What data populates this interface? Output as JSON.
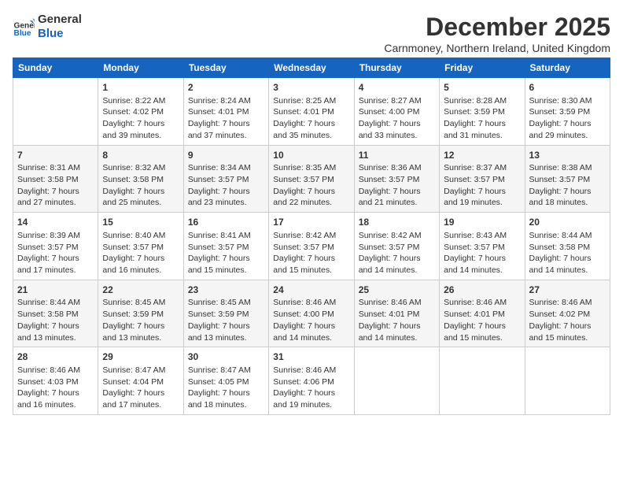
{
  "header": {
    "logo_line1": "General",
    "logo_line2": "Blue",
    "month": "December 2025",
    "location": "Carnmoney, Northern Ireland, United Kingdom"
  },
  "weekdays": [
    "Sunday",
    "Monday",
    "Tuesday",
    "Wednesday",
    "Thursday",
    "Friday",
    "Saturday"
  ],
  "weeks": [
    [
      {
        "day": "",
        "sunrise": "",
        "sunset": "",
        "daylight": ""
      },
      {
        "day": "1",
        "sunrise": "Sunrise: 8:22 AM",
        "sunset": "Sunset: 4:02 PM",
        "daylight": "Daylight: 7 hours and 39 minutes."
      },
      {
        "day": "2",
        "sunrise": "Sunrise: 8:24 AM",
        "sunset": "Sunset: 4:01 PM",
        "daylight": "Daylight: 7 hours and 37 minutes."
      },
      {
        "day": "3",
        "sunrise": "Sunrise: 8:25 AM",
        "sunset": "Sunset: 4:01 PM",
        "daylight": "Daylight: 7 hours and 35 minutes."
      },
      {
        "day": "4",
        "sunrise": "Sunrise: 8:27 AM",
        "sunset": "Sunset: 4:00 PM",
        "daylight": "Daylight: 7 hours and 33 minutes."
      },
      {
        "day": "5",
        "sunrise": "Sunrise: 8:28 AM",
        "sunset": "Sunset: 3:59 PM",
        "daylight": "Daylight: 7 hours and 31 minutes."
      },
      {
        "day": "6",
        "sunrise": "Sunrise: 8:30 AM",
        "sunset": "Sunset: 3:59 PM",
        "daylight": "Daylight: 7 hours and 29 minutes."
      }
    ],
    [
      {
        "day": "7",
        "sunrise": "Sunrise: 8:31 AM",
        "sunset": "Sunset: 3:58 PM",
        "daylight": "Daylight: 7 hours and 27 minutes."
      },
      {
        "day": "8",
        "sunrise": "Sunrise: 8:32 AM",
        "sunset": "Sunset: 3:58 PM",
        "daylight": "Daylight: 7 hours and 25 minutes."
      },
      {
        "day": "9",
        "sunrise": "Sunrise: 8:34 AM",
        "sunset": "Sunset: 3:57 PM",
        "daylight": "Daylight: 7 hours and 23 minutes."
      },
      {
        "day": "10",
        "sunrise": "Sunrise: 8:35 AM",
        "sunset": "Sunset: 3:57 PM",
        "daylight": "Daylight: 7 hours and 22 minutes."
      },
      {
        "day": "11",
        "sunrise": "Sunrise: 8:36 AM",
        "sunset": "Sunset: 3:57 PM",
        "daylight": "Daylight: 7 hours and 21 minutes."
      },
      {
        "day": "12",
        "sunrise": "Sunrise: 8:37 AM",
        "sunset": "Sunset: 3:57 PM",
        "daylight": "Daylight: 7 hours and 19 minutes."
      },
      {
        "day": "13",
        "sunrise": "Sunrise: 8:38 AM",
        "sunset": "Sunset: 3:57 PM",
        "daylight": "Daylight: 7 hours and 18 minutes."
      }
    ],
    [
      {
        "day": "14",
        "sunrise": "Sunrise: 8:39 AM",
        "sunset": "Sunset: 3:57 PM",
        "daylight": "Daylight: 7 hours and 17 minutes."
      },
      {
        "day": "15",
        "sunrise": "Sunrise: 8:40 AM",
        "sunset": "Sunset: 3:57 PM",
        "daylight": "Daylight: 7 hours and 16 minutes."
      },
      {
        "day": "16",
        "sunrise": "Sunrise: 8:41 AM",
        "sunset": "Sunset: 3:57 PM",
        "daylight": "Daylight: 7 hours and 15 minutes."
      },
      {
        "day": "17",
        "sunrise": "Sunrise: 8:42 AM",
        "sunset": "Sunset: 3:57 PM",
        "daylight": "Daylight: 7 hours and 15 minutes."
      },
      {
        "day": "18",
        "sunrise": "Sunrise: 8:42 AM",
        "sunset": "Sunset: 3:57 PM",
        "daylight": "Daylight: 7 hours and 14 minutes."
      },
      {
        "day": "19",
        "sunrise": "Sunrise: 8:43 AM",
        "sunset": "Sunset: 3:57 PM",
        "daylight": "Daylight: 7 hours and 14 minutes."
      },
      {
        "day": "20",
        "sunrise": "Sunrise: 8:44 AM",
        "sunset": "Sunset: 3:58 PM",
        "daylight": "Daylight: 7 hours and 14 minutes."
      }
    ],
    [
      {
        "day": "21",
        "sunrise": "Sunrise: 8:44 AM",
        "sunset": "Sunset: 3:58 PM",
        "daylight": "Daylight: 7 hours and 13 minutes."
      },
      {
        "day": "22",
        "sunrise": "Sunrise: 8:45 AM",
        "sunset": "Sunset: 3:59 PM",
        "daylight": "Daylight: 7 hours and 13 minutes."
      },
      {
        "day": "23",
        "sunrise": "Sunrise: 8:45 AM",
        "sunset": "Sunset: 3:59 PM",
        "daylight": "Daylight: 7 hours and 13 minutes."
      },
      {
        "day": "24",
        "sunrise": "Sunrise: 8:46 AM",
        "sunset": "Sunset: 4:00 PM",
        "daylight": "Daylight: 7 hours and 14 minutes."
      },
      {
        "day": "25",
        "sunrise": "Sunrise: 8:46 AM",
        "sunset": "Sunset: 4:01 PM",
        "daylight": "Daylight: 7 hours and 14 minutes."
      },
      {
        "day": "26",
        "sunrise": "Sunrise: 8:46 AM",
        "sunset": "Sunset: 4:01 PM",
        "daylight": "Daylight: 7 hours and 15 minutes."
      },
      {
        "day": "27",
        "sunrise": "Sunrise: 8:46 AM",
        "sunset": "Sunset: 4:02 PM",
        "daylight": "Daylight: 7 hours and 15 minutes."
      }
    ],
    [
      {
        "day": "28",
        "sunrise": "Sunrise: 8:46 AM",
        "sunset": "Sunset: 4:03 PM",
        "daylight": "Daylight: 7 hours and 16 minutes."
      },
      {
        "day": "29",
        "sunrise": "Sunrise: 8:47 AM",
        "sunset": "Sunset: 4:04 PM",
        "daylight": "Daylight: 7 hours and 17 minutes."
      },
      {
        "day": "30",
        "sunrise": "Sunrise: 8:47 AM",
        "sunset": "Sunset: 4:05 PM",
        "daylight": "Daylight: 7 hours and 18 minutes."
      },
      {
        "day": "31",
        "sunrise": "Sunrise: 8:46 AM",
        "sunset": "Sunset: 4:06 PM",
        "daylight": "Daylight: 7 hours and 19 minutes."
      },
      {
        "day": "",
        "sunrise": "",
        "sunset": "",
        "daylight": ""
      },
      {
        "day": "",
        "sunrise": "",
        "sunset": "",
        "daylight": ""
      },
      {
        "day": "",
        "sunrise": "",
        "sunset": "",
        "daylight": ""
      }
    ]
  ]
}
